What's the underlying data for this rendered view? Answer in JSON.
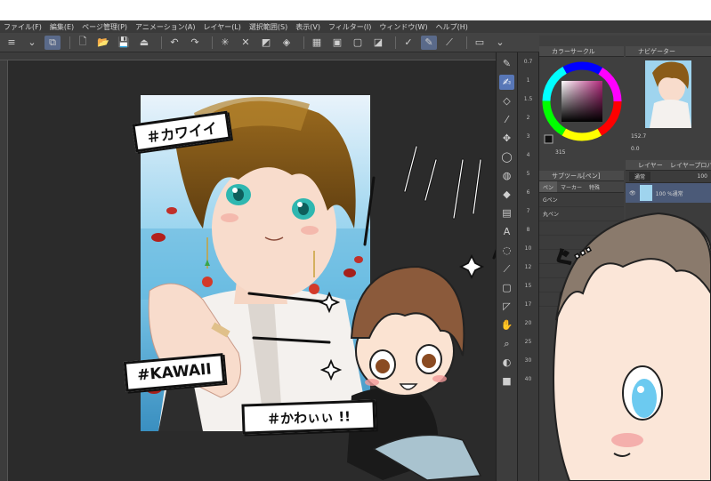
{
  "menubar": {
    "items": [
      "ファイル(F)",
      "編集(E)",
      "ページ管理(P)",
      "アニメーション(A)",
      "レイヤー(L)",
      "選択範囲(S)",
      "表示(V)",
      "フィルター(I)",
      "ウィンドウ(W)",
      "ヘルプ(H)"
    ]
  },
  "panels": {
    "color_circle_title": "カラーサークル",
    "navigator_title": "ナビゲーター",
    "navigator_zoom": "152.7",
    "navigator_rotation": "0.0",
    "color_values": "315",
    "sub_tool_title": "サブツール[ペン]",
    "sub_tool_tabs": [
      "ペン",
      "マーカー",
      "特殊"
    ],
    "sub_tool_items": [
      "Gペン",
      "丸ペン"
    ],
    "layer_title": "レイヤー",
    "layer_property_title": "レイヤープロパティ",
    "blend_mode": "通常",
    "opacity": "100",
    "layer_name": "100 %通常"
  },
  "brush_sizes": [
    "0.7",
    "1",
    "1.5",
    "2",
    "3",
    "4",
    "5",
    "6",
    "7",
    "8",
    "10",
    "12",
    "15",
    "17",
    "20",
    "25",
    "30",
    "40"
  ],
  "captions": {
    "kawaii_katakana": "＃カワイイ",
    "kawaii_roman": "#KAWAII",
    "kawaii_hiragana": "＃かわぃぃ !!",
    "sfx": "ぐ…"
  },
  "colors": {
    "menubar_bg": "#3a3a3a",
    "canvas_bg": "#2b2b2b",
    "panel_bg": "#3f3f3f",
    "accent": "#5877b7"
  }
}
